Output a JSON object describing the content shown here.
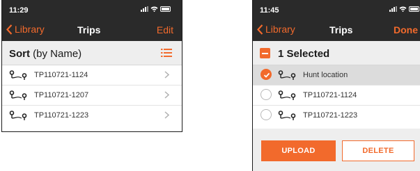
{
  "colors": {
    "accent": "#f26a2c",
    "bar": "#2a2a2a",
    "section": "#eeeeee",
    "selected_row": "#dcdcdc"
  },
  "screen_left": {
    "status_time": "11:29",
    "nav": {
      "back_label": "Library",
      "title": "Trips",
      "action": "Edit"
    },
    "sort": {
      "bold": "Sort",
      "rest": " (by Name)",
      "icon": "list-sort-icon"
    },
    "rows": [
      {
        "label": "TP110721-1124",
        "icon": "route-pin-icon"
      },
      {
        "label": "TP110721-1207",
        "icon": "route-pin-icon"
      },
      {
        "label": "TP110721-1223",
        "icon": "route-pin-icon"
      }
    ]
  },
  "screen_right": {
    "status_time": "11:45",
    "nav": {
      "back_label": "Library",
      "title": "Trips",
      "action": "Done"
    },
    "selection": {
      "label": "1 Selected"
    },
    "rows": [
      {
        "label": "Hunt location",
        "checked": true,
        "icon": "route-pin-icon"
      },
      {
        "label": "TP110721-1124",
        "checked": false,
        "icon": "route-pin-icon"
      },
      {
        "label": "TP110721-1223",
        "checked": false,
        "icon": "route-pin-icon"
      }
    ],
    "buttons": {
      "upload": "UPLOAD",
      "delete": "DELETE"
    }
  }
}
